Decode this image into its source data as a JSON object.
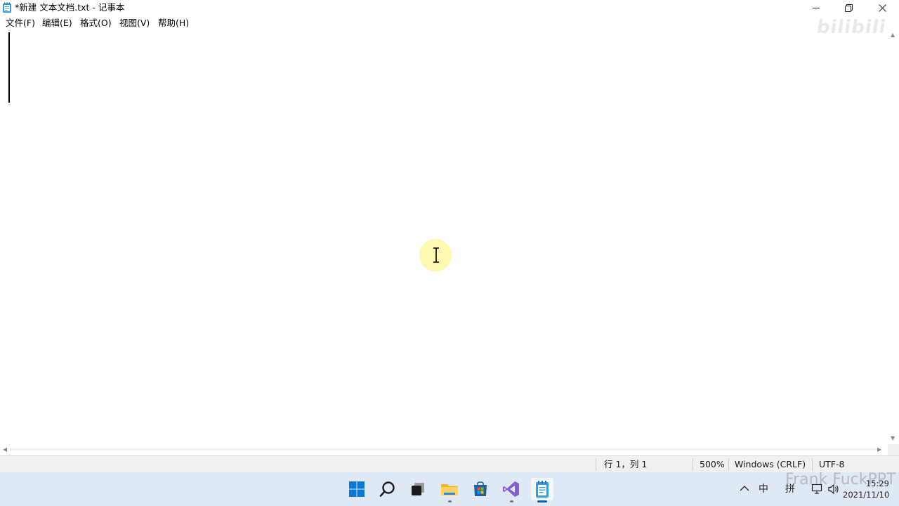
{
  "window": {
    "title": "*新建 文本文档.txt - 记事本",
    "icon": "notepad-icon"
  },
  "menu": {
    "items": [
      "文件(F)",
      "编辑(E)",
      "格式(O)",
      "视图(V)",
      "帮助(H)"
    ]
  },
  "editor": {
    "content": "",
    "watermark": "bilibili"
  },
  "status": {
    "position": "行 1，列 1",
    "zoom": "500%",
    "line_ending": "Windows (CRLF)",
    "encoding": "UTF-8"
  },
  "taskbar": {
    "apps": [
      "start-icon",
      "search-icon",
      "task-view-icon",
      "file-explorer-icon",
      "microsoft-store-icon",
      "visual-studio-icon",
      "notepad-icon"
    ],
    "active_app": "notepad-icon"
  },
  "tray": {
    "ime_mode": "中",
    "ime_layout": "拼",
    "time": "15:29",
    "date": "2021/11/10",
    "overlay_text": "Frank  FuckPPT"
  },
  "colors": {
    "taskbar": "#dfe9f5",
    "accent": "#0067c0",
    "status_bar": "#f0f0f0"
  }
}
